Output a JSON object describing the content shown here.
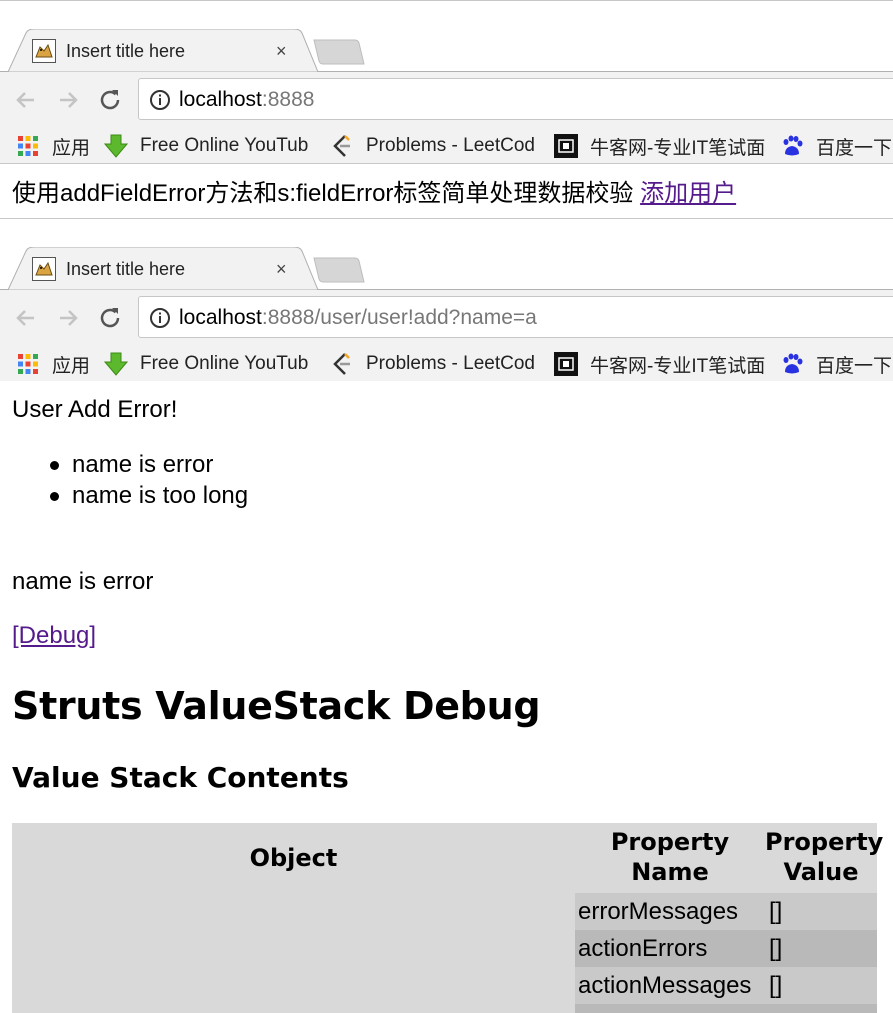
{
  "window1": {
    "tab_title": "Insert title here",
    "tab_close": "×",
    "url_host": "localhost",
    "url_rest": ":8888"
  },
  "window2": {
    "tab_title": "Insert title here",
    "tab_close": "×",
    "url_host": "localhost",
    "url_rest": ":8888/user/user!add?name=a"
  },
  "bookmarks": [
    {
      "label": "应用",
      "icon": "apps-grid-icon"
    },
    {
      "label": "Free Online YouTub",
      "icon": "green-download-arrow-icon"
    },
    {
      "label": "Problems - LeetCod",
      "icon": "leetcode-icon"
    },
    {
      "label": "牛客网-专业IT笔试面",
      "icon": "nowcoder-icon"
    },
    {
      "label": "百度一下",
      "icon": "baidu-paw-icon"
    }
  ],
  "page1": {
    "text": "使用addFieldError方法和s:fieldError标签简单处理数据校验 ",
    "link": "添加用户"
  },
  "page2": {
    "heading": "User Add Error!",
    "errors": [
      "name is error",
      "name is too long"
    ],
    "field_error": "name is error",
    "debug_link": "[Debug]",
    "title": "Struts ValueStack Debug",
    "subtitle": "Value Stack Contents",
    "table": {
      "col_object": "Object",
      "col_prop_name": "Property Name",
      "col_prop_value": "Property Value",
      "rows": [
        {
          "name": "errorMessages",
          "value": "[]"
        },
        {
          "name": "actionErrors",
          "value": "[]"
        },
        {
          "name": "actionMessages",
          "value": "[]"
        }
      ]
    }
  },
  "colors": {
    "link": "#551a8b",
    "toolbar_bg": "#f2f2f2",
    "table_bg": "#d9d9d9",
    "row_odd": "#c9c9c9",
    "row_even": "#b9b9b9"
  }
}
